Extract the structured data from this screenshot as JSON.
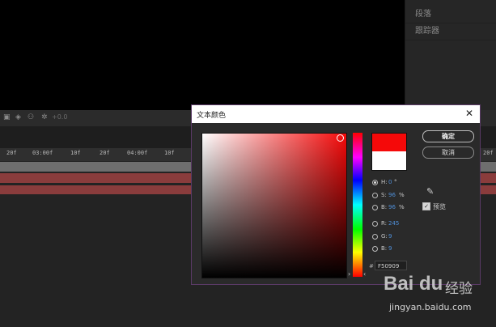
{
  "right_panel": {
    "items": [
      "段落",
      "跟踪器"
    ]
  },
  "toolbar": {
    "time_value": "+0.0"
  },
  "timeline": {
    "ticks": [
      "20f",
      "03:00f",
      "10f",
      "20f",
      "04:00f",
      "10f",
      "20f"
    ]
  },
  "dialog": {
    "title": "文本颜色",
    "ok_label": "确定",
    "cancel_label": "取消",
    "preview_label": "预览",
    "preview_checked": true,
    "current_color": "#F50909",
    "previous_color": "#FFFFFF",
    "hsb": {
      "h": {
        "label": "H:",
        "value": "0",
        "unit": "°",
        "selected": true
      },
      "s": {
        "label": "S:",
        "value": "96",
        "unit": "%",
        "selected": false
      },
      "b": {
        "label": "B:",
        "value": "96",
        "unit": "%",
        "selected": false
      }
    },
    "rgb": {
      "r": {
        "label": "R:",
        "value": "245"
      },
      "g": {
        "label": "G:",
        "value": "9"
      },
      "b": {
        "label": "B:",
        "value": "9"
      }
    },
    "hex_prefix": "#",
    "hex_value": "F50909"
  },
  "watermark": {
    "logo": "Bai du",
    "cn": "经验",
    "url": "jingyan.baidu.com"
  }
}
